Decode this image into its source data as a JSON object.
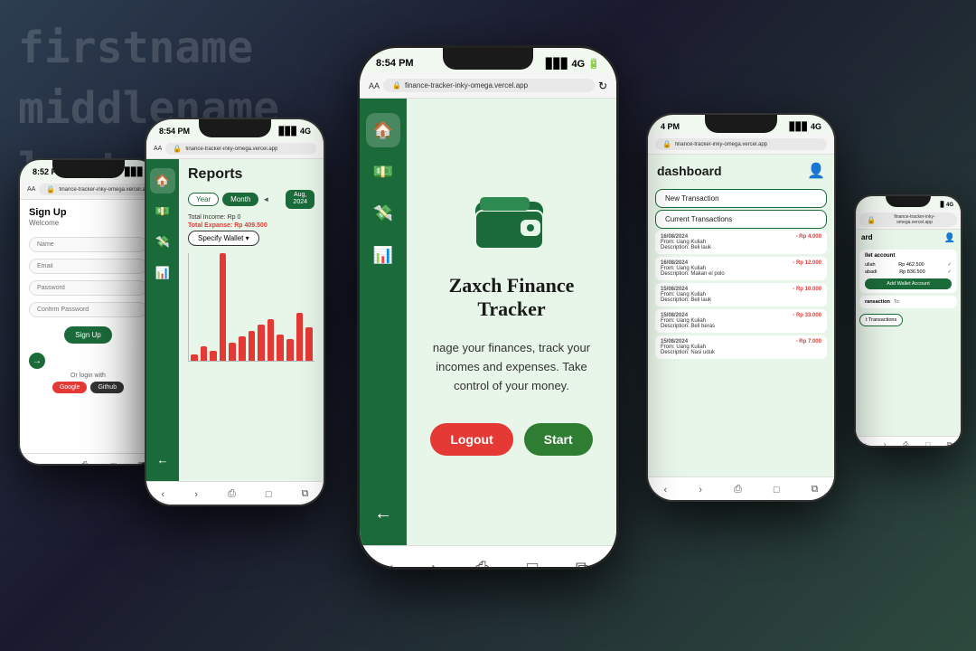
{
  "background": {
    "text": "firstname\nmiddlename\nlastname\nLA"
  },
  "center_phone": {
    "status_bar": {
      "time": "8:54 PM",
      "signal": "4G",
      "battery": "■■■"
    },
    "browser": {
      "aa": "AA",
      "lock": "🔒",
      "url": "finance-tracker-inky-omega.vercel.app",
      "reload": "↻"
    },
    "app_title": "Zaxch Finance Tracker",
    "description": "nage your finances, track your\nincomes and expenses. Take\ncontrol of your money.",
    "btn_logout": "Logout",
    "btn_start": "Start",
    "nav": {
      "home_icon": "🏠",
      "money_icon": "💵",
      "transfer_icon": "💸",
      "chart_icon": "📊",
      "back_icon": "←"
    },
    "bottom_nav": [
      "‹",
      "›",
      "⎙",
      "□",
      "⧉"
    ]
  },
  "left_center_phone": {
    "status_bar": {
      "time": "8:54 PM",
      "signal": "4G"
    },
    "browser_url": "finance-tracker-inky-omega.vercel.app",
    "page_title": "Reports",
    "filter_year": "Year",
    "filter_month": "Month",
    "month_badge": "Aug,\n2024",
    "total_income": "Total Income: Rp 0",
    "total_expanse": "Total Expanse:",
    "total_expanse_value": "Rp 409.500",
    "specify_wallet": "Specify Wallet ▾",
    "chart_bars": [
      5,
      12,
      8,
      90,
      15,
      20,
      25,
      30,
      35,
      22,
      18,
      40,
      28
    ]
  },
  "right_center_phone": {
    "status_bar": {
      "time": "4 PM",
      "signal": "4G"
    },
    "browser_url": "finance-tracker-inky-omega.vercel.app",
    "page_title": "dashboard",
    "btn_new_transaction": "New Transaction",
    "btn_current_transactions": "Current Transactions",
    "transactions": [
      {
        "date": "16/08/2024",
        "from": "From: Uang Kuliah",
        "desc": "Description: Beli lauk",
        "amount": "- Rp 4.000"
      },
      {
        "date": "16/08/2024",
        "from": "From: Uang Kuliah",
        "desc": "Description: Makan el polo",
        "amount": "- Rp 12.000"
      },
      {
        "date": "15/08/2024",
        "from": "From: Uang Kuliah",
        "desc": "Description: Beli lauk",
        "amount": "- Rp 10.000"
      },
      {
        "date": "15/08/2024",
        "from": "From: Uang Kuliah",
        "desc": "Description: Beli beras",
        "amount": "- Rp 33.000"
      },
      {
        "date": "15/08/2024",
        "from": "From: Uang Kuliah",
        "desc": "Description: Nasi uduk",
        "amount": "- Rp 7.000"
      }
    ]
  },
  "far_left_phone": {
    "status_bar": {
      "time": "8:52 PM"
    },
    "browser_url": "finance-tracker-inky-omega.vercel.app",
    "page_title": "Sign Up",
    "page_subtitle": "Welcome",
    "inputs": [
      "Name",
      "Email",
      "Password",
      "Confirm Password"
    ],
    "btn_signup": "Sign Up",
    "or_login": "Or login with",
    "btn_google": "Google",
    "btn_github": "Github"
  },
  "far_right_phone": {
    "status_bar": {
      "time": "4G"
    },
    "browser_url": "finance-tracker-inky-omega.vercel.app",
    "page_title": "ard",
    "wallet_section_title": "llet account",
    "wallets": [
      {
        "name": "uliah",
        "amount": "Rp 462.500"
      },
      {
        "name": "abadi",
        "amount": "Rp 836.500"
      }
    ],
    "btn_add_wallet": "Add Wallet Account",
    "transaction_label": "ransaction",
    "transaction_to": "To:",
    "btn_list": "t Transactions"
  },
  "colors": {
    "green_dark": "#1b6b3a",
    "green_light": "#e8f5e9",
    "red": "#e53935",
    "white": "#ffffff",
    "black": "#1a1a1a"
  }
}
